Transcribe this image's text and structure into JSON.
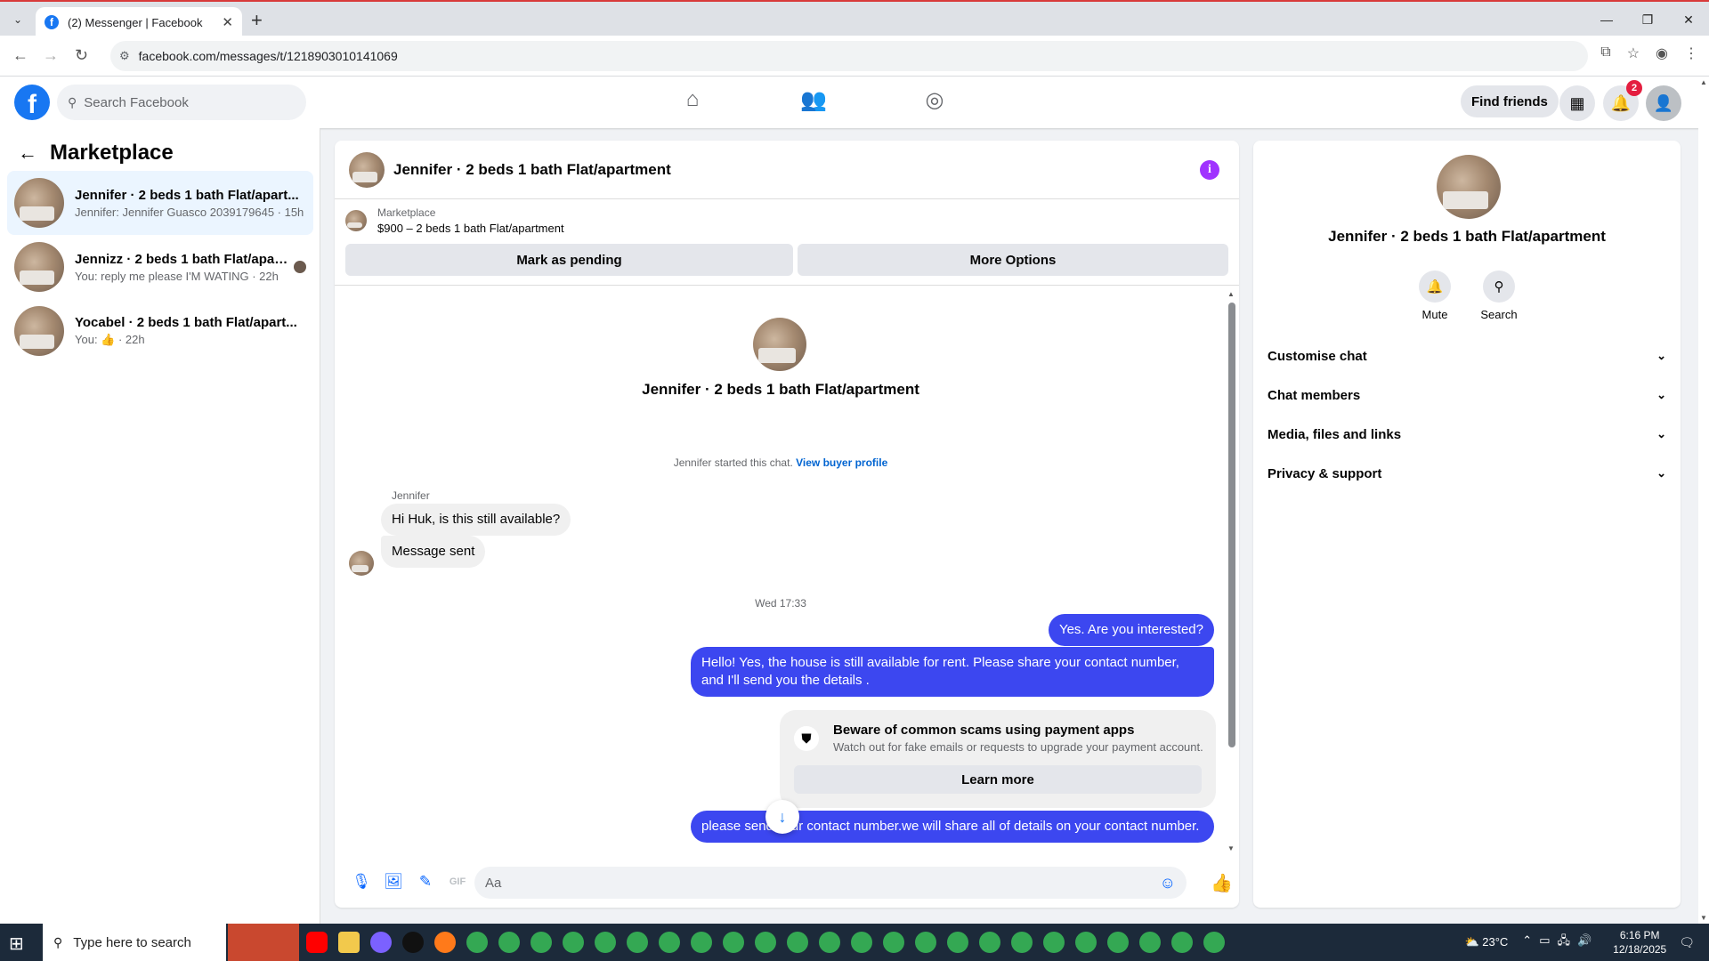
{
  "browser": {
    "tab_title": "(2) Messenger | Facebook",
    "tab_close": "✕",
    "new_tab": "+",
    "url": "facebook.com/messages/t/1218903010141069",
    "controls": [
      "—",
      "❐",
      "✕"
    ]
  },
  "header": {
    "logo": "f",
    "search_placeholder": "Search Facebook",
    "find_friends": "Find friends",
    "notification_count": "2",
    "nav_icons": [
      "home-icon",
      "friends-icon",
      "groups-icon"
    ]
  },
  "sidebar": {
    "title": "Marketplace",
    "chats": [
      {
        "name": "Jennifer · 2 beds 1 bath Flat/apart...",
        "snippet": "Jennifer: Jennifer Guasco 2039179645 · 15h"
      },
      {
        "name": "Jennizz · 2 beds 1 bath Flat/apar...",
        "snippet": "You: reply me please I'M WATING · 22h"
      },
      {
        "name": "Yocabel · 2 beds 1 bath Flat/apart...",
        "snippet": "You: 👍 · 22h"
      }
    ]
  },
  "conversation": {
    "title": "Jennifer · 2 beds 1 bath Flat/apartment",
    "marketplace_label": "Marketplace",
    "listing": "$900 – 2 beds 1 bath Flat/apartment",
    "mark_pending": "Mark as pending",
    "more_options": "More Options",
    "center_title": "Jennifer · 2 beds 1 bath Flat/apartment",
    "system_text": "Jennifer started this chat.",
    "system_link": "View buyer profile",
    "sender": "Jennifer",
    "messages": [
      {
        "dir": "in",
        "text": "Hi Huk, is this still available?"
      },
      {
        "dir": "in",
        "text": "Message sent"
      },
      {
        "dir": "out",
        "text": "Yes. Are you interested?"
      },
      {
        "dir": "out",
        "text": "Hello! Yes, the house is still available for rent. Please share your contact number, and I'll send you the details ."
      },
      {
        "dir": "out",
        "text": "please send your contact number.we will share all of details on your contact number."
      }
    ],
    "timestamp": "Wed 17:33",
    "scam": {
      "title": "Beware of common scams using payment apps",
      "subtitle": "Watch out for fake emails or requests to upgrade your payment account.",
      "button": "Learn more"
    },
    "composer_placeholder": "Aa"
  },
  "details": {
    "title": "Jennifer · 2 beds 1 bath Flat/apartment",
    "actions": [
      "Mute",
      "Search"
    ],
    "sections": [
      "Customise chat",
      "Chat members",
      "Media, files and links",
      "Privacy & support"
    ]
  },
  "taskbar": {
    "search_placeholder": "Type here to search",
    "temperature": "23°C",
    "time": "6:16 PM",
    "date": "12/18/2025"
  },
  "colors": {
    "brand": "#1877f2",
    "outgoing_bubble": "#3c47f0",
    "info": "#a033ff"
  }
}
